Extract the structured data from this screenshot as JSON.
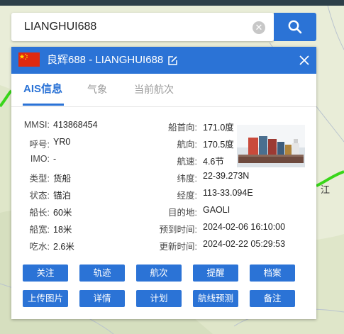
{
  "colors": {
    "accent": "#2b73d6",
    "flag_red": "#de2910",
    "flag_yellow": "#ffde00",
    "route_green": "#39d61a"
  },
  "search": {
    "value": "LIANGHUI688",
    "clear_icon": "close-circle-icon",
    "search_icon": "search-icon"
  },
  "map": {
    "place_label": "江"
  },
  "panel": {
    "title": "良辉688 -   LIANGHUI688",
    "edit_icon": "edit-icon",
    "close_icon": "close-icon",
    "tabs": [
      {
        "label": "AIS信息",
        "active": true
      },
      {
        "label": "气象",
        "active": false
      },
      {
        "label": "当前航次",
        "active": false
      }
    ],
    "left_fields": [
      {
        "label": "MMSI:",
        "value": "413868454"
      },
      {
        "label": "呼号:",
        "value": "YR0"
      },
      {
        "label": "IMO:",
        "value": "-"
      },
      {
        "label": "类型:",
        "value": "货船"
      },
      {
        "label": "状态:",
        "value": "锚泊"
      },
      {
        "label": "船长:",
        "value": "60米"
      },
      {
        "label": "船宽:",
        "value": "18米"
      },
      {
        "label": "吃水:",
        "value": "2.6米"
      }
    ],
    "right_fields": [
      {
        "label": "船首向:",
        "value": "171.0度"
      },
      {
        "label": "航向:",
        "value": "170.5度"
      },
      {
        "label": "航速:",
        "value": "4.6节"
      },
      {
        "label": "纬度:",
        "value": "22-39.273N"
      },
      {
        "label": "经度:",
        "value": "113-33.094E"
      },
      {
        "label": "目的地:",
        "value": "GAOLI"
      },
      {
        "label": "预到时间:",
        "value": "2024-02-06 16:10:00"
      },
      {
        "label": "更新时间:",
        "value": "2024-02-22 05:29:53"
      }
    ],
    "buttons_row1": [
      "关注",
      "轨迹",
      "航次",
      "提醒",
      "档案"
    ],
    "buttons_row2": [
      "上传图片",
      "详情",
      "计划",
      "航线预测",
      "备注"
    ]
  }
}
